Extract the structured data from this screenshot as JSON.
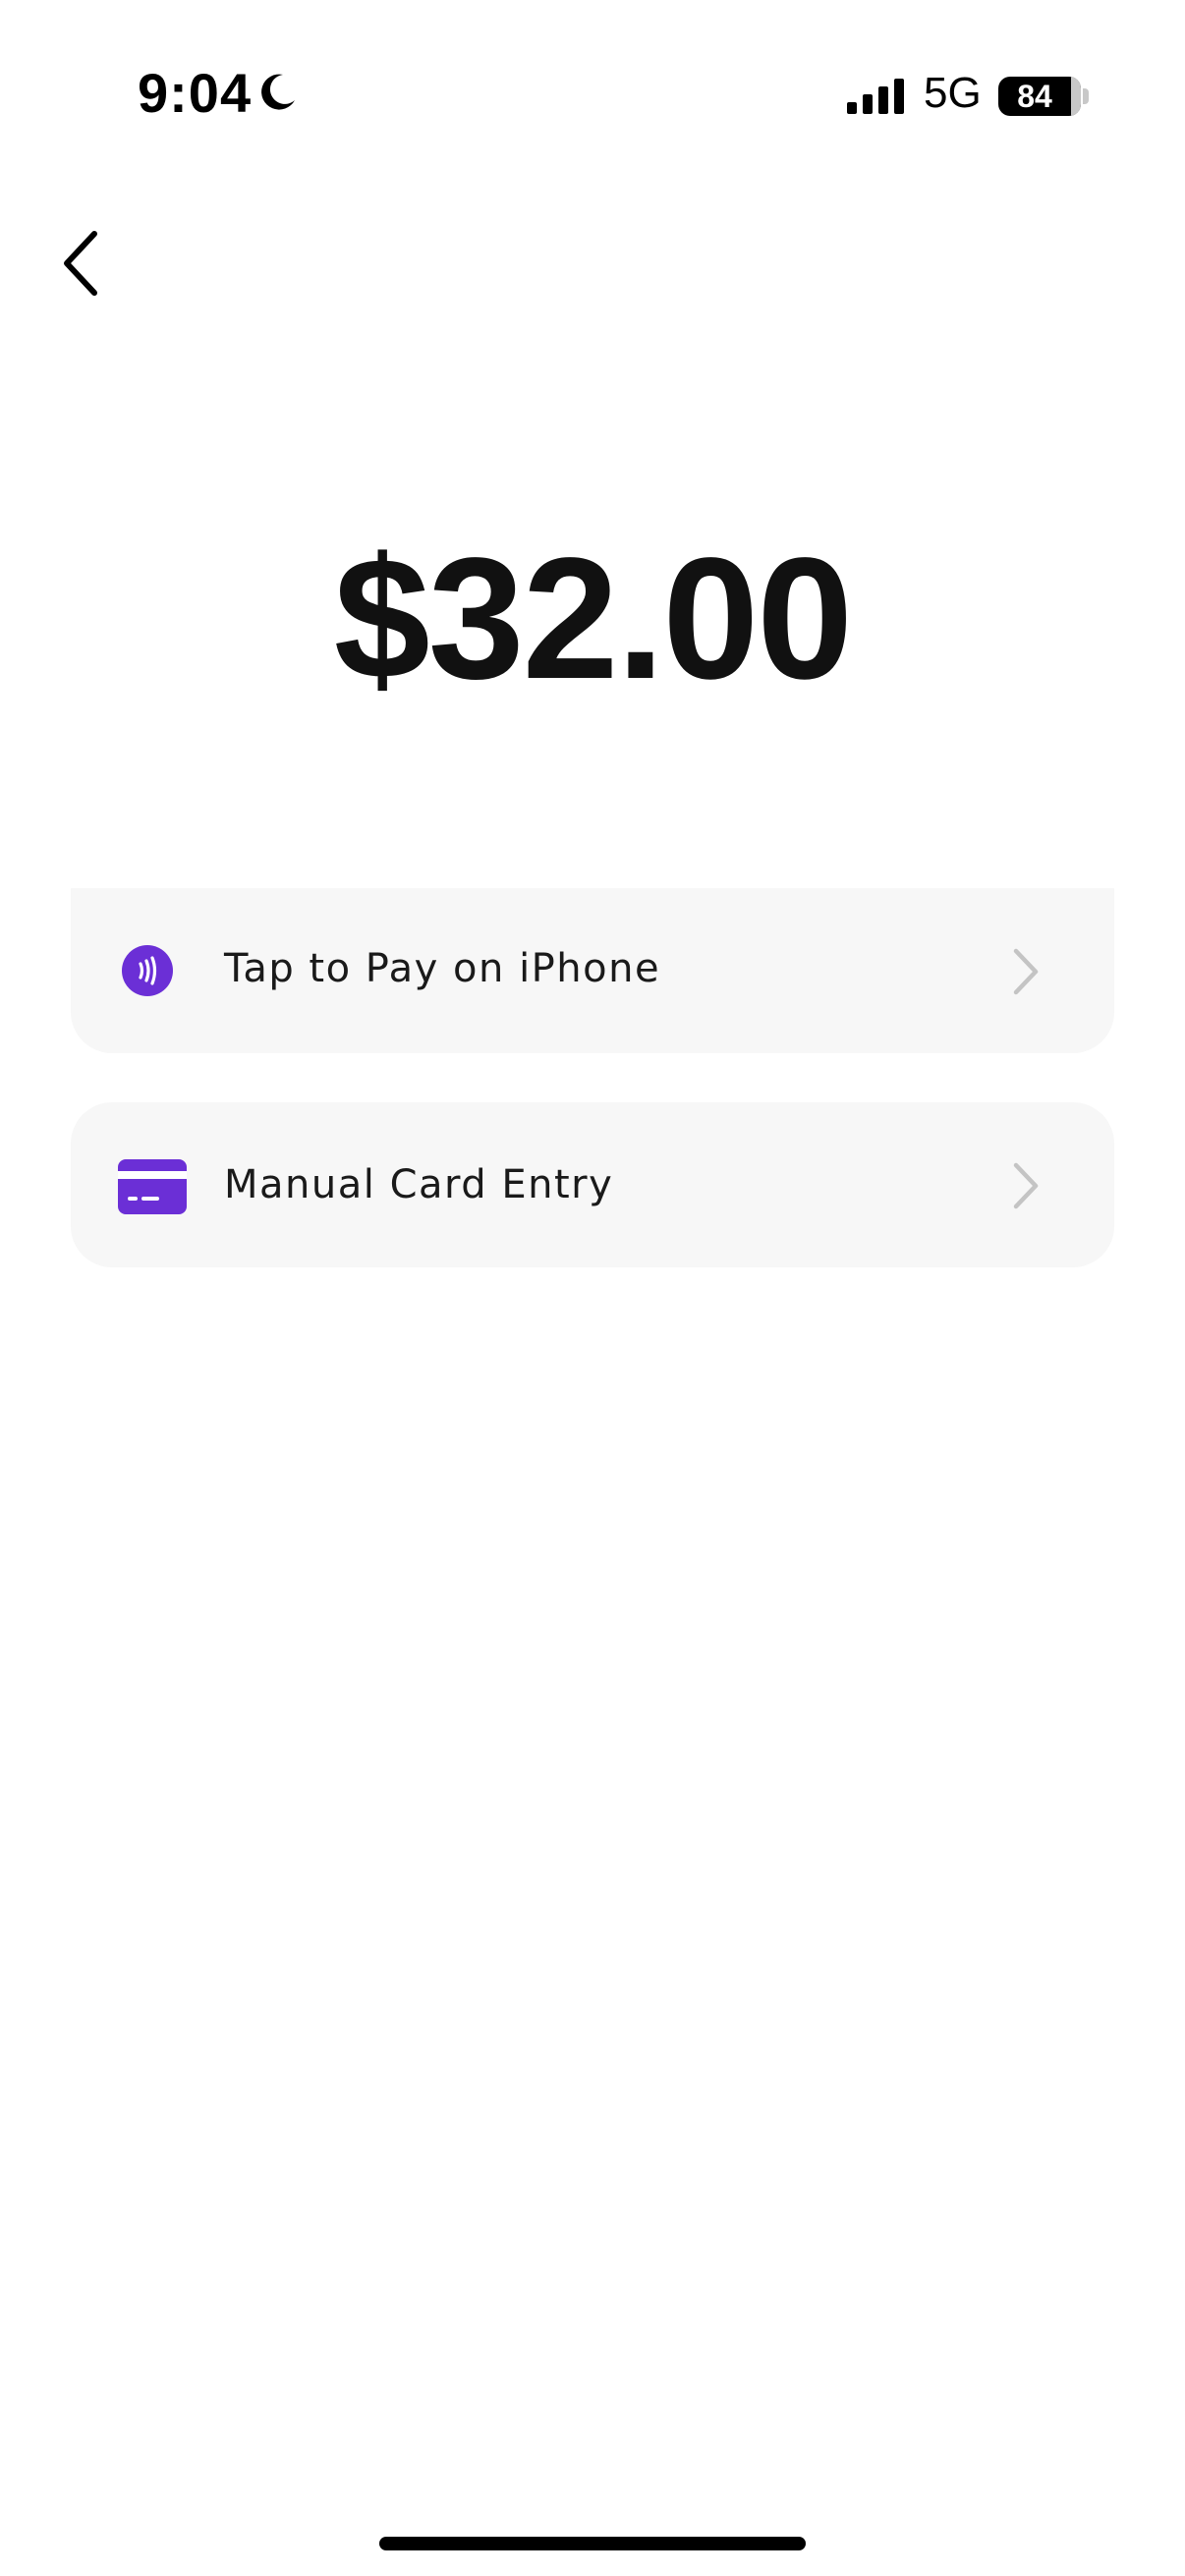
{
  "status_bar": {
    "time": "9:04",
    "network": "5G",
    "battery_level": "84",
    "icons": [
      "moon-icon",
      "signal-icon",
      "battery-icon"
    ]
  },
  "navigation": {
    "back_icon": "chevron-left-icon"
  },
  "payment": {
    "amount": "$32.00"
  },
  "options": [
    {
      "label": "Tap to Pay on iPhone",
      "icon": "contactless-icon",
      "chevron": "chevron-right-icon"
    },
    {
      "label": "Manual Card Entry",
      "icon": "credit-card-icon",
      "chevron": "chevron-right-icon"
    }
  ],
  "colors": {
    "accent": "#6b2fd6",
    "option_background": "#f7f7f7",
    "chevron": "#c4c4c4",
    "text": "#111111"
  }
}
